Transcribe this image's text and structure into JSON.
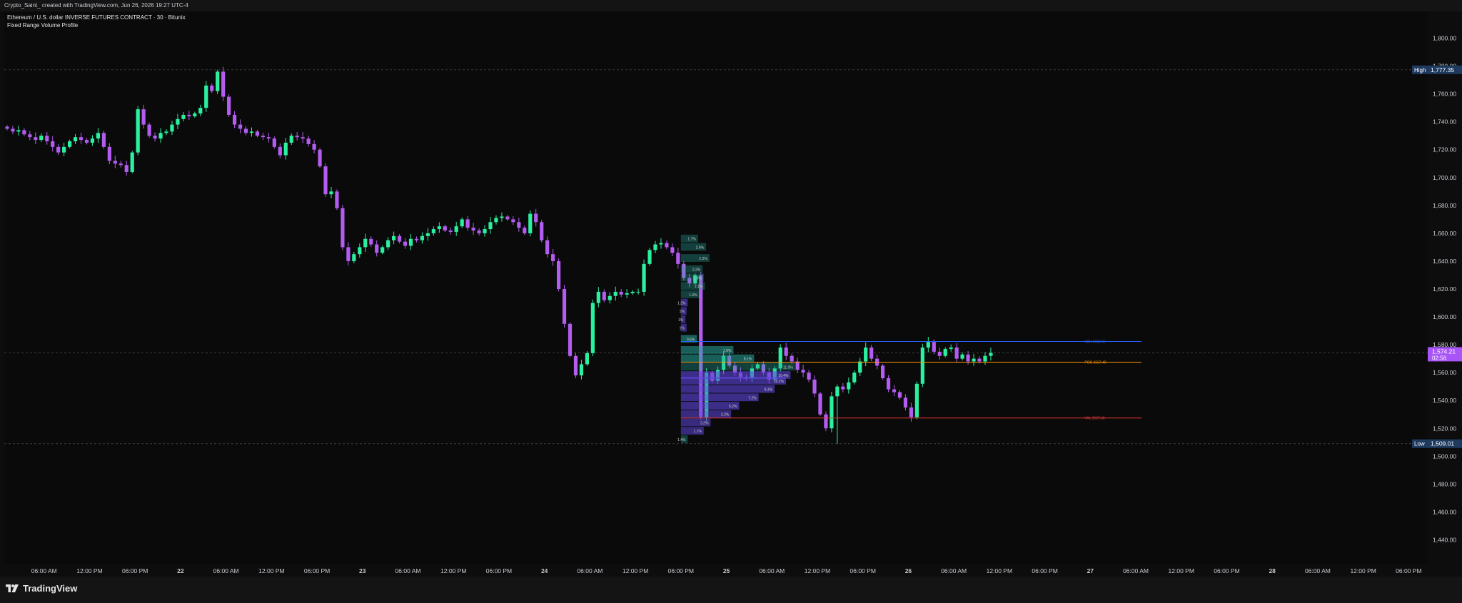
{
  "header": {
    "snapshot_text": "Crypto_Saint_ created with TradingView.com, Jun 26, 2026 19:27 UTC-4"
  },
  "legend": {
    "symbol_line": "Ethereum / U.S. dollar INVERSE FUTURES CONTRACT · 30 · Bitunix",
    "indicator_line": "Fixed Range Volume Profile"
  },
  "footer": {
    "brand": "TradingView",
    "logo_icon": "tradingview-logo-icon"
  },
  "colors": {
    "up": "#2af0a0",
    "down": "#b25cf0",
    "background": "#0a0a0a",
    "vah": "#2962ff",
    "poc": "#ff9800",
    "val": "#e53935"
  },
  "chart_data": {
    "type": "candlestick",
    "title": "",
    "ylabel": "",
    "ylim": [
      1430,
      1810
    ],
    "y_ticks": [
      "1,800.00",
      "1,780.00",
      "1,760.00",
      "1,740.00",
      "1,720.00",
      "1,700.00",
      "1,680.00",
      "1,660.00",
      "1,640.00",
      "1,620.00",
      "1,600.00",
      "1,580.00",
      "1,560.00",
      "1,540.00",
      "1,520.00",
      "1,500.00",
      "1,480.00",
      "1,460.00",
      "1,440.00"
    ],
    "y_tick_values": [
      1800,
      1780,
      1760,
      1740,
      1720,
      1700,
      1680,
      1660,
      1640,
      1620,
      1600,
      1580,
      1560,
      1540,
      1520,
      1500,
      1480,
      1460,
      1440
    ],
    "x_range": [
      0,
      250
    ],
    "x_ticks": [
      {
        "label": "06:00 AM",
        "bar": 7
      },
      {
        "label": "12:00 PM",
        "bar": 15
      },
      {
        "label": "06:00 PM",
        "bar": 23
      },
      {
        "label": "22",
        "bar": 31
      },
      {
        "label": "06:00 AM",
        "bar": 39
      },
      {
        "label": "12:00 PM",
        "bar": 47
      },
      {
        "label": "06:00 PM",
        "bar": 55
      },
      {
        "label": "23",
        "bar": 63
      },
      {
        "label": "06:00 AM",
        "bar": 71
      },
      {
        "label": "12:00 PM",
        "bar": 79
      },
      {
        "label": "06:00 PM",
        "bar": 87
      },
      {
        "label": "24",
        "bar": 95
      },
      {
        "label": "06:00 AM",
        "bar": 103
      },
      {
        "label": "12:00 PM",
        "bar": 111
      },
      {
        "label": "06:00 PM",
        "bar": 119
      },
      {
        "label": "25",
        "bar": 127
      },
      {
        "label": "06:00 AM",
        "bar": 135
      },
      {
        "label": "12:00 PM",
        "bar": 143
      },
      {
        "label": "06:00 PM",
        "bar": 151
      },
      {
        "label": "26",
        "bar": 159
      },
      {
        "label": "06:00 AM",
        "bar": 167
      },
      {
        "label": "12:00 PM",
        "bar": 175
      },
      {
        "label": "06:00 PM",
        "bar": 183
      },
      {
        "label": "27",
        "bar": 191
      },
      {
        "label": "06:00 AM",
        "bar": 199
      },
      {
        "label": "12:00 PM",
        "bar": 207
      },
      {
        "label": "06:00 PM",
        "bar": 215
      },
      {
        "label": "28",
        "bar": 223
      },
      {
        "label": "06:00 AM",
        "bar": 231
      },
      {
        "label": "12:00 PM",
        "bar": 239
      },
      {
        "label": "06:00 PM",
        "bar": 247
      }
    ],
    "high": {
      "tag": "High",
      "label": "1,777.35",
      "value": 1777.35
    },
    "low": {
      "tag": "Low",
      "label": "1,509.01",
      "value": 1509.01
    },
    "last_price": {
      "label": "1,574.21",
      "countdown": "02:56",
      "value": 1574.21
    },
    "closes": [
      1735,
      1733,
      1734,
      1731,
      1729,
      1727,
      1730,
      1726,
      1722,
      1718,
      1722,
      1726,
      1729,
      1727,
      1725,
      1728,
      1732,
      1722,
      1712,
      1710,
      1709,
      1704,
      1718,
      1749,
      1738,
      1730,
      1728,
      1732,
      1733,
      1738,
      1742,
      1745,
      1744,
      1746,
      1750,
      1766,
      1762,
      1776,
      1758,
      1745,
      1738,
      1735,
      1732,
      1733,
      1730,
      1729,
      1728,
      1722,
      1716,
      1725,
      1730,
      1729,
      1728,
      1724,
      1720,
      1708,
      1688,
      1690,
      1678,
      1650,
      1640,
      1645,
      1650,
      1656,
      1652,
      1646,
      1650,
      1655,
      1658,
      1654,
      1651,
      1656,
      1655,
      1658,
      1660,
      1663,
      1665,
      1662,
      1661,
      1665,
      1670,
      1664,
      1662,
      1660,
      1663,
      1668,
      1671,
      1672,
      1670,
      1668,
      1664,
      1660,
      1674,
      1668,
      1655,
      1645,
      1640,
      1620,
      1595,
      1572,
      1558,
      1566,
      1574,
      1610,
      1618,
      1612,
      1615,
      1618,
      1616,
      1617,
      1618,
      1618,
      1638,
      1648,
      1652,
      1653,
      1650,
      1646,
      1638,
      1628,
      1624,
      1630,
      1528,
      1560,
      1554,
      1562,
      1572,
      1565,
      1560,
      1557,
      1556,
      1563,
      1566,
      1560,
      1555,
      1563,
      1578,
      1572,
      1568,
      1562,
      1560,
      1555,
      1545,
      1530,
      1520,
      1543,
      1550,
      1548,
      1553,
      1560,
      1568,
      1578,
      1570,
      1565,
      1556,
      1548,
      1546,
      1542,
      1535,
      1528,
      1552,
      1578,
      1582,
      1575,
      1572,
      1577,
      1578,
      1570,
      1573,
      1568,
      1570,
      1568,
      1572,
      1574.21
    ],
    "volume_profile": {
      "start_bar": 119,
      "bins": [
        {
          "price": 1512,
          "pct": "1.4%",
          "ratio": 0.06,
          "in_va": true
        },
        {
          "price": 1518,
          "pct": "1.1%",
          "ratio": 0.2,
          "in_va": false
        },
        {
          "price": 1524,
          "pct": "3.2%",
          "ratio": 0.26,
          "in_va": false
        },
        {
          "price": 1530,
          "pct": "3.2%",
          "ratio": 0.44,
          "in_va": false
        },
        {
          "price": 1536,
          "pct": "5.2%",
          "ratio": 0.51,
          "in_va": false
        },
        {
          "price": 1542,
          "pct": "7.2%",
          "ratio": 0.68,
          "in_va": false
        },
        {
          "price": 1548,
          "pct": "9.3%",
          "ratio": 0.82,
          "in_va": false
        },
        {
          "price": 1554,
          "pct": "10.2%",
          "ratio": 0.92,
          "in_va": false
        },
        {
          "price": 1558,
          "pct": "10.4%",
          "ratio": 0.96,
          "in_va": true
        },
        {
          "price": 1564,
          "pct": "11.0%",
          "ratio": 1.0,
          "in_va": true
        },
        {
          "price": 1570,
          "pct": "8.1%",
          "ratio": 0.64,
          "in_va": true
        },
        {
          "price": 1576,
          "pct": "7.9%",
          "ratio": 0.46,
          "in_va": true
        },
        {
          "price": 1584,
          "pct": "0.6%",
          "ratio": 0.14,
          "in_va": true
        },
        {
          "price": 1592,
          "pct": "1%",
          "ratio": 0.05,
          "in_va": false
        },
        {
          "price": 1598,
          "pct": "1%",
          "ratio": 0.04,
          "in_va": false
        },
        {
          "price": 1604,
          "pct": "1%",
          "ratio": 0.05,
          "in_va": false
        },
        {
          "price": 1610,
          "pct": "1.2%",
          "ratio": 0.06,
          "in_va": false
        },
        {
          "price": 1616,
          "pct": "1.3%",
          "ratio": 0.16,
          "in_va": true
        },
        {
          "price": 1622,
          "pct": "2.1%",
          "ratio": 0.21,
          "in_va": true
        },
        {
          "price": 1628,
          "pct": "1.9%",
          "ratio": 0.2,
          "in_va": true
        },
        {
          "price": 1634,
          "pct": "2.2%",
          "ratio": 0.19,
          "in_va": true
        },
        {
          "price": 1642,
          "pct": "2.2%",
          "ratio": 0.25,
          "in_va": true
        },
        {
          "price": 1650,
          "pct": "2.9%",
          "ratio": 0.22,
          "in_va": true
        },
        {
          "price": 1656,
          "pct": "1.7%",
          "ratio": 0.15,
          "in_va": true
        }
      ],
      "vah": {
        "label": "VAH 1582.35",
        "value": 1582.35
      },
      "poc": {
        "label": "POC 1567.49",
        "value": 1567.49
      },
      "val": {
        "label": "VAL 1527.46",
        "value": 1527.46
      }
    }
  }
}
